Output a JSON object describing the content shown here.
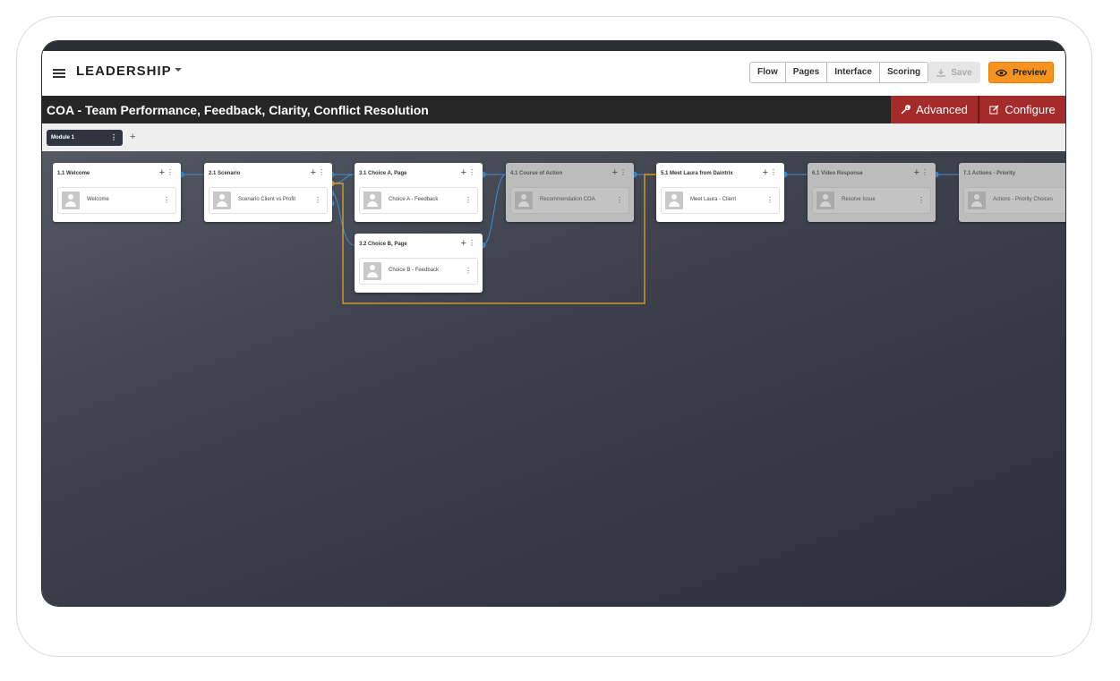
{
  "header": {
    "app_title": "LEADERSHIP",
    "view_tabs": [
      "Flow",
      "Pages",
      "Interface",
      "Scoring"
    ],
    "save_label": "Save",
    "preview_label": "Preview"
  },
  "titlebar": {
    "course_title": "COA - Team Performance, Feedback, Clarity, Conflict Resolution",
    "advanced_label": "Advanced",
    "configure_label": "Configure"
  },
  "modules": {
    "active_tab": "Module 1",
    "add_symbol": "+"
  },
  "nodes": [
    {
      "title": "1.1 Welcome",
      "page": "Welcome",
      "dimmed": false
    },
    {
      "title": "2.1 Scenario",
      "page": "Scenario Client vs Profit",
      "dimmed": false
    },
    {
      "title": "3.1 Choice A, Page",
      "page": "Choice A - Feedback",
      "dimmed": false
    },
    {
      "title": "3.2 Choice B, Page",
      "page": "Choice B - Feedback",
      "dimmed": false
    },
    {
      "title": "4.1 Course of Action",
      "page": "Recommendation COA",
      "dimmed": true
    },
    {
      "title": "5.1 Meet Laura from Daintrix",
      "page": "Meet Laura - Client",
      "dimmed": false
    },
    {
      "title": "6.1 Video Response",
      "page": "Resolve Issue",
      "dimmed": true
    },
    {
      "title": "7.1 Actions - Priority",
      "page": "Actions - Priority Choices",
      "dimmed": true
    }
  ],
  "colors": {
    "accent_orange": "#f7931e",
    "connector_blue": "#3a8fd8",
    "connector_orange": "#f5a623",
    "danger_red": "#a52a2a",
    "titlebar_dark": "#262626"
  },
  "icons": {
    "menu": "hamburger-icon",
    "save": "download-icon",
    "preview": "eye-icon",
    "advanced": "wrench-icon",
    "configure": "edit-icon",
    "page": "user-avatar-icon"
  }
}
